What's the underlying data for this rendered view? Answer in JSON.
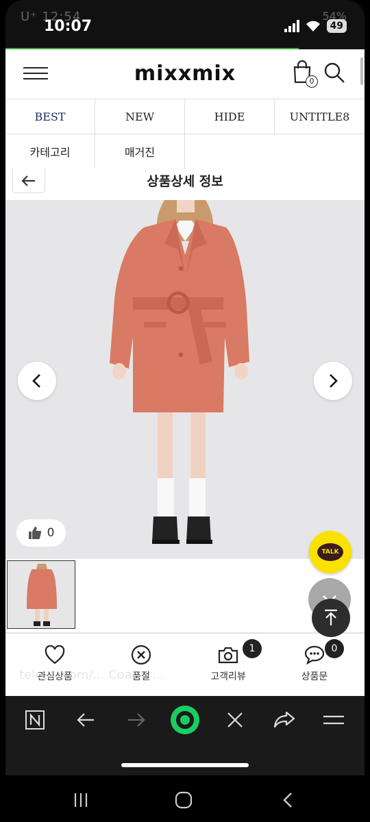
{
  "status": {
    "time": "10:07",
    "battery": "49",
    "ghost_left": "U⁺ 12:54",
    "ghost_right": "54%"
  },
  "header": {
    "logo": "mixxmix",
    "cart_count": "0"
  },
  "tabs": {
    "row1": [
      "BEST",
      "NEW",
      "HIDE",
      "UNTITLE8"
    ],
    "row2": [
      "카테고리",
      "매거진"
    ]
  },
  "sub_header": {
    "title": "상품상세 정보"
  },
  "product": {
    "coat_color": "#d97a64",
    "background": "#e6e6e8",
    "likes": "0"
  },
  "floating": {
    "kakao_label": "TALK"
  },
  "actions": [
    {
      "label": "관심상품",
      "icon": "heart-icon"
    },
    {
      "label": "품절",
      "icon": "x-circle-icon"
    },
    {
      "label": "고객리뷰",
      "icon": "camera-icon",
      "badge": "1"
    },
    {
      "label": "상품문",
      "icon": "chat-icon",
      "badge": "0"
    }
  ],
  "ghost_url": "tele... .com/... Coat... ...",
  "browser_bar": [
    "n-icon",
    "back-icon",
    "forward-icon",
    "home-icon",
    "close-icon",
    "share-icon",
    "menu-icon"
  ]
}
